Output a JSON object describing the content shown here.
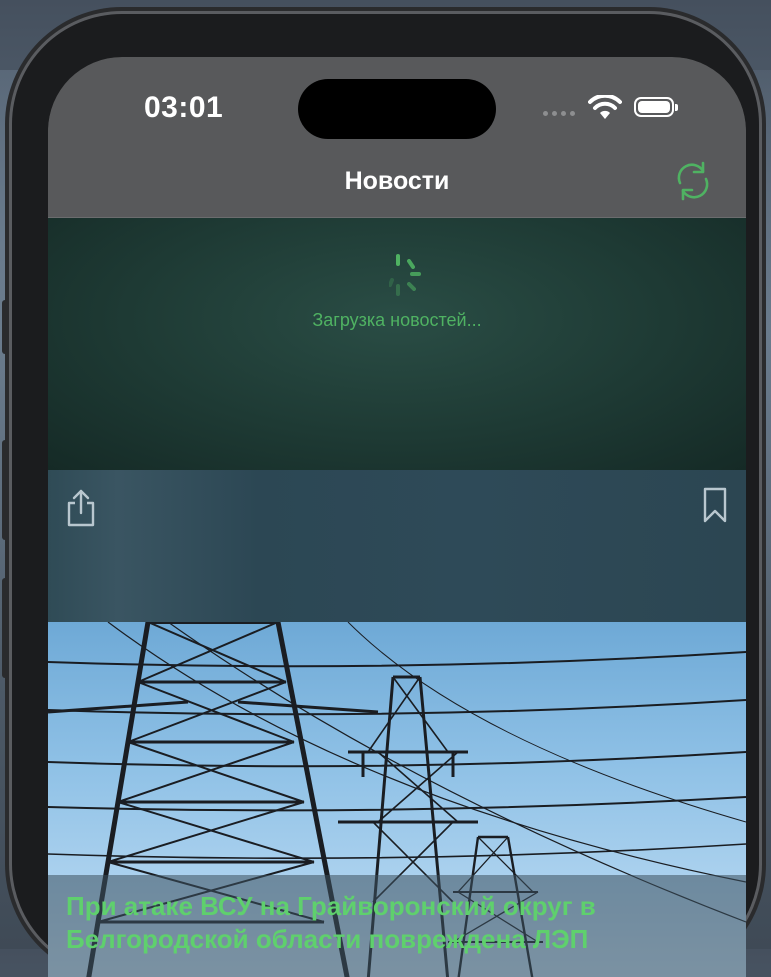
{
  "status_bar": {
    "time": "03:01"
  },
  "nav": {
    "title": "Новости",
    "refresh_icon": "refresh-arrows-icon"
  },
  "loading": {
    "text": "Загрузка новостей..."
  },
  "card": {
    "share_icon": "share-icon",
    "bookmark_icon": "bookmark-icon",
    "image_subject": "power-line-towers",
    "title": "При атаке ВСУ на Грайворонский округ в Белгородской области повреждена ЛЭП"
  },
  "colors": {
    "accent": "#4fb262",
    "bar": "#58595b",
    "loading_bg": "#1e3a34",
    "toolbar_bg": "#2e4a58"
  }
}
